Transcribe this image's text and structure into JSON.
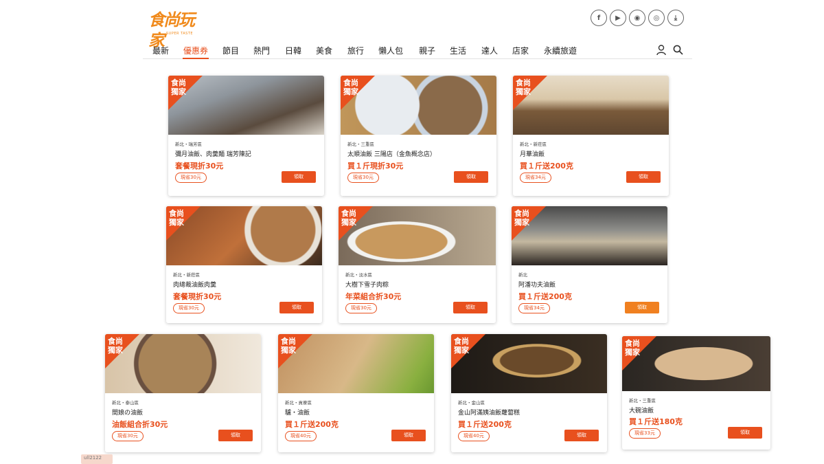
{
  "header": {
    "logo_text": "食尚玩家",
    "logo_sub": "SUPER TASTE",
    "social": [
      {
        "icon": "facebook-icon",
        "glyph": "f"
      },
      {
        "icon": "youtube-icon",
        "glyph": "▶"
      },
      {
        "icon": "line-icon",
        "glyph": "◉"
      },
      {
        "icon": "instagram-icon",
        "glyph": "◎"
      },
      {
        "icon": "download-app-icon",
        "glyph": "⤓"
      }
    ]
  },
  "nav": {
    "items": [
      "最新",
      "優惠券",
      "節目",
      "熱門",
      "日韓",
      "美食",
      "旅行",
      "懶人包",
      "親子",
      "生活",
      "達人",
      "店家",
      "永續旅遊"
    ],
    "active_index": 1,
    "user_icon": "user-icon",
    "search_icon": "search-icon"
  },
  "colors": {
    "accent": "#e8501e",
    "accent_alt": "#f08020",
    "logo": "#f08a1c"
  },
  "ribbon": "食尚獨家",
  "cards": [
    {
      "loc": "新北・瑞芳區",
      "name": "彌月油飯、肉羹麵 瑞芳陳記",
      "offer": "套餐現折30元",
      "save": "現省30元",
      "button": "領取"
    },
    {
      "loc": "新北・三重區",
      "name": "太順油飯 三陽店（金魚概念店）",
      "offer": "買１斤現折30元",
      "save": "現省30元",
      "button": "領取"
    },
    {
      "loc": "新北・新莊區",
      "name": "月華油飯",
      "offer": "買１斤送200克",
      "save": "現省34元",
      "button": "領取"
    },
    {
      "loc": "新北・新莊區",
      "name": "肉總裁油飯肉羹",
      "offer": "套餐現折30元",
      "save": "現省30元",
      "button": "領取"
    },
    {
      "loc": "新北・淡水區",
      "name": "大樹下雪子肉粽",
      "offer": "年菜組合折30元",
      "save": "現省30元",
      "button": "領取"
    },
    {
      "loc": "新北",
      "name": "阿潘功夫油飯",
      "offer": "買１斤送200克",
      "save": "現省34元",
      "button": "領取"
    },
    {
      "loc": "新北・泰山區",
      "name": "間娘の油飯",
      "offer": "油飯組合折30元",
      "save": "現省30元",
      "button": "領取"
    },
    {
      "loc": "新北・貢寮區",
      "name": "驢・油飯",
      "offer": "買１斤送200克",
      "save": "現省40元",
      "button": "領取"
    },
    {
      "loc": "新北・金山區",
      "name": "金山阿滿姨油飯蘿蔔糕",
      "offer": "買１斤送200克",
      "save": "現省40元",
      "button": "領取"
    },
    {
      "loc": "新北・三重區",
      "name": "大碗油飯",
      "offer": "買１斤送180克",
      "save": "現省33元",
      "button": "領取"
    }
  ],
  "stub_text": "ull2122"
}
